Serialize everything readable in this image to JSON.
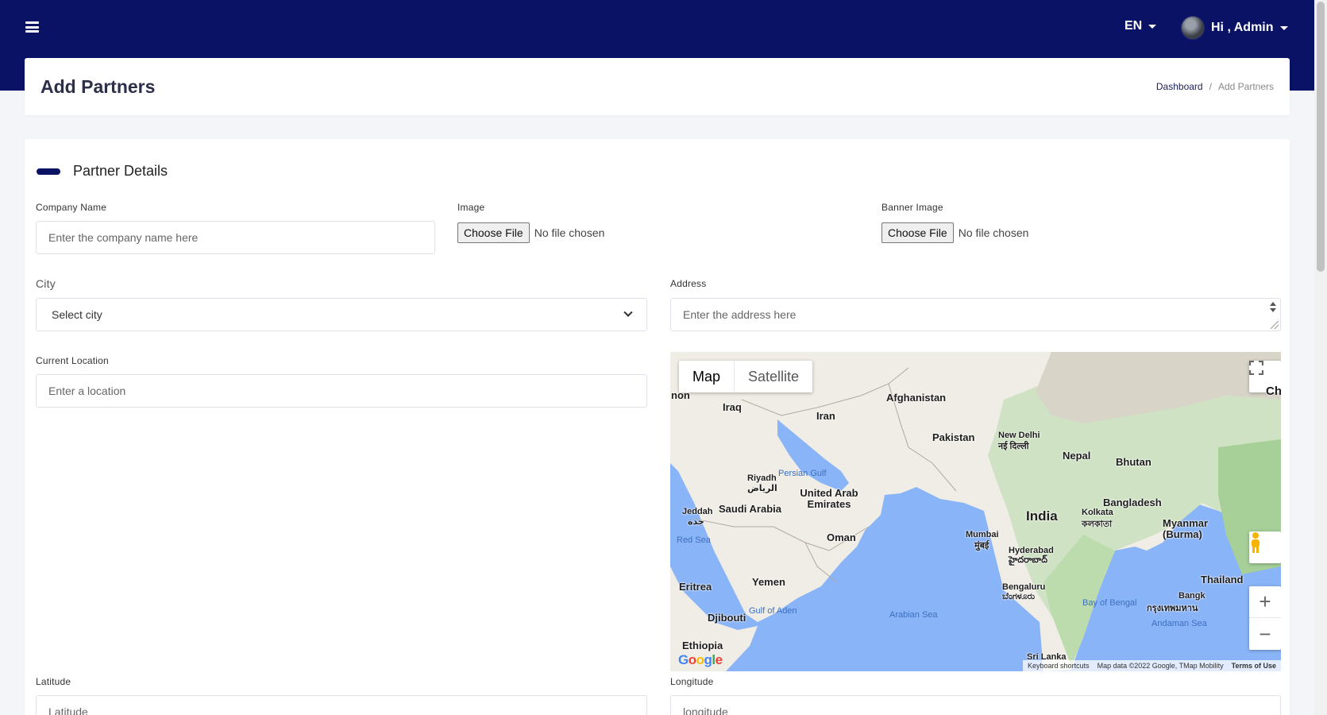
{
  "topbar": {
    "lang": "EN",
    "greeting": "Hi , Admin"
  },
  "page": {
    "title": "Add Partners",
    "breadcrumb": [
      "Dashboard",
      "/",
      "Add Partners"
    ]
  },
  "section": {
    "title": "Partner Details"
  },
  "form": {
    "company_name": {
      "label": "Company Name",
      "placeholder": "Enter the company name here"
    },
    "image": {
      "label": "Image",
      "button": "Choose File",
      "status": "No file chosen"
    },
    "banner_image": {
      "label": "Banner Image",
      "button": "Choose File",
      "status": "No file chosen"
    },
    "city": {
      "label": "City",
      "selected": "Select city"
    },
    "address": {
      "label": "Address",
      "placeholder": "Enter the address here"
    },
    "current_location": {
      "label": "Current Location",
      "placeholder": "Enter a location"
    },
    "latitude": {
      "label": "Latitude",
      "placeholder": "Latitude"
    },
    "longitude": {
      "label": "Longitude",
      "placeholder": "longitude"
    }
  },
  "map": {
    "tabs": [
      "Map",
      "Satellite"
    ],
    "labels": {
      "afghanistan": "Afghanistan",
      "iraq": "Iraq",
      "iran": "Iran",
      "pakistan": "Pakistan",
      "new_delhi": "New Delhi",
      "new_delhi_hi": "नई दिल्ली",
      "nepal": "Nepal",
      "bhutan": "Bhutan",
      "riyadh": "Riyadh",
      "riyadh_ar": "الرياض",
      "persian_gulf": "Persian Gulf",
      "uae": "United Arab Emirates",
      "saudi": "Saudi Arabia",
      "jeddah": "Jeddah",
      "jeddah_ar": "جدة",
      "bangladesh": "Bangladesh",
      "india": "India",
      "kolkata": "Kolkata",
      "kolkata_bn": "কলকাতা",
      "myanmar": "Myanmar (Burma)",
      "red_sea": "Red Sea",
      "oman": "Oman",
      "mumbai": "Mumbai",
      "mumbai_mr": "मुंबई",
      "hyderabad": "Hyderabad",
      "hyderabad_te": "హైదరాబాద్",
      "yemen": "Yemen",
      "eritrea": "Eritrea",
      "thailand": "Thailand",
      "bangalore": "Bengaluru",
      "bangalore_kn": "ಬೆಂಗಳೂರು",
      "bangkok": "Bangk",
      "bangkok_th": "กรุงเทพมหาน",
      "gulf_aden": "Gulf of Aden",
      "arabian_sea": "Arabian Sea",
      "bay_bengal": "Bay of Bengal",
      "andaman": "Andaman Sea",
      "djibouti": "Djibouti",
      "ethiopia": "Ethiopia",
      "sri_lanka": "Sri Lanka",
      "lebanon": "non",
      "china": "Ch"
    },
    "footer": {
      "shortcuts": "Keyboard shortcuts",
      "data": "Map data ©2022 Google, TMap Mobility",
      "terms": "Terms of Use"
    },
    "logo": "Google"
  }
}
